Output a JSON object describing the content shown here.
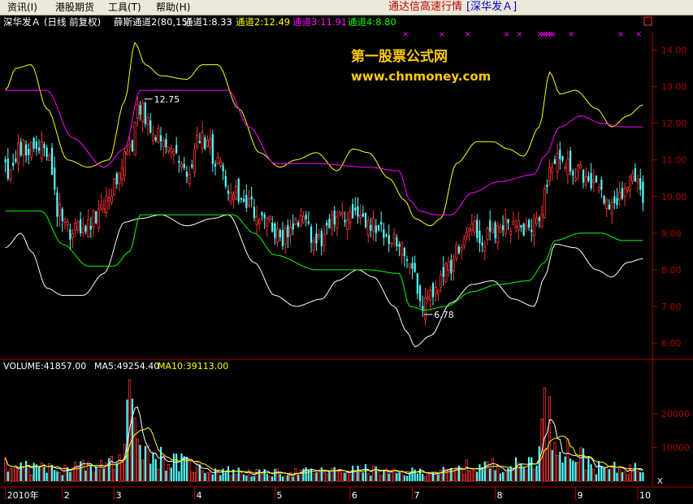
{
  "menu": {
    "items": [
      "资讯(I)",
      "港股期货",
      "工具(T)",
      "帮助(H)"
    ],
    "title": "通达信高速行情",
    "symbol": "[深华发Ａ]"
  },
  "header": {
    "stock_name": "深华发Ａ",
    "period": "(日线 前复权)",
    "indicator": "薛斯通道2(80,15)",
    "channels": [
      {
        "label": "通道1:8.33",
        "color": "#ffffff"
      },
      {
        "label": "通道2:12.49",
        "color": "#ffff00"
      },
      {
        "label": "通道3:11.91",
        "color": "#ff00ff"
      },
      {
        "label": "通道4:8.80",
        "color": "#00ff00"
      }
    ],
    "window_box": "□"
  },
  "watermark": {
    "line1": "第一股票公式网",
    "line2": "www.chnmoney.com"
  },
  "annotations": {
    "high": "12.75",
    "low": "6.78"
  },
  "volume_header": {
    "volume": "VOLUME:41857.00",
    "ma5": "MA5:49254.40",
    "ma10": "MA10:39113.00"
  },
  "volume_corner": "X",
  "colors": {
    "up": "#ff3232",
    "down": "#54fcfc",
    "axis": "#b00000",
    "ch1": "#ffffff",
    "ch2": "#ffff00",
    "ch3": "#ff00ff",
    "ch4": "#00ff00",
    "x_marker": "#ff00ff"
  },
  "chart_data": [
    {
      "type": "candlestick",
      "ylim": [
        5.6,
        14.5
      ],
      "y_ticks": [
        6.0,
        7.0,
        8.0,
        9.0,
        10.0,
        11.0,
        12.0,
        13.0,
        14.0
      ],
      "close_anchors": [
        [
          0,
          10.7
        ],
        [
          6,
          11.3
        ],
        [
          12,
          11.4
        ],
        [
          16,
          11.1
        ],
        [
          20,
          9.7
        ],
        [
          26,
          9.0
        ],
        [
          32,
          9.2
        ],
        [
          36,
          9.5
        ],
        [
          42,
          10.3
        ],
        [
          48,
          11.2
        ],
        [
          52,
          12.5
        ],
        [
          56,
          11.9
        ],
        [
          62,
          11.3
        ],
        [
          70,
          10.8
        ],
        [
          76,
          11.6
        ],
        [
          82,
          11.0
        ],
        [
          86,
          10.3
        ],
        [
          92,
          9.8
        ],
        [
          100,
          9.3
        ],
        [
          108,
          8.9
        ],
        [
          114,
          9.3
        ],
        [
          120,
          8.7
        ],
        [
          126,
          9.4
        ],
        [
          132,
          9.4
        ],
        [
          136,
          9.5
        ],
        [
          140,
          9.2
        ],
        [
          146,
          9.0
        ],
        [
          152,
          8.8
        ],
        [
          158,
          7.8
        ],
        [
          160,
          7.1
        ],
        [
          164,
          7.3
        ],
        [
          170,
          7.9
        ],
        [
          176,
          8.6
        ],
        [
          180,
          9.2
        ],
        [
          184,
          8.8
        ],
        [
          188,
          9.0
        ],
        [
          194,
          9.3
        ],
        [
          200,
          9.0
        ],
        [
          206,
          9.5
        ],
        [
          210,
          10.6
        ],
        [
          212,
          11.1
        ],
        [
          218,
          10.8
        ],
        [
          224,
          10.6
        ],
        [
          228,
          10.2
        ],
        [
          232,
          9.8
        ],
        [
          238,
          10.1
        ],
        [
          244,
          10.5
        ],
        [
          246,
          10.0
        ]
      ],
      "channel1_white_anchors": [
        [
          0,
          8.6
        ],
        [
          6,
          9.0
        ],
        [
          10,
          8.5
        ],
        [
          16,
          7.5
        ],
        [
          22,
          7.3
        ],
        [
          30,
          7.3
        ],
        [
          38,
          7.9
        ],
        [
          46,
          9.3
        ],
        [
          52,
          9.4
        ],
        [
          60,
          9.5
        ],
        [
          70,
          9.2
        ],
        [
          80,
          9.4
        ],
        [
          86,
          9.5
        ],
        [
          96,
          8.2
        ],
        [
          104,
          7.3
        ],
        [
          112,
          7.0
        ],
        [
          122,
          7.2
        ],
        [
          128,
          7.7
        ],
        [
          136,
          8.0
        ],
        [
          142,
          7.8
        ],
        [
          150,
          7.0
        ],
        [
          155,
          6.3
        ],
        [
          158,
          5.9
        ],
        [
          164,
          6.2
        ],
        [
          172,
          7.1
        ],
        [
          180,
          7.6
        ],
        [
          188,
          7.7
        ],
        [
          196,
          7.2
        ],
        [
          204,
          7.0
        ],
        [
          208,
          7.8
        ],
        [
          212,
          8.7
        ],
        [
          220,
          8.6
        ],
        [
          228,
          8.0
        ],
        [
          234,
          7.8
        ],
        [
          240,
          8.2
        ],
        [
          246,
          8.3
        ]
      ],
      "channel2_yellow_anchors": [
        [
          0,
          12.9
        ],
        [
          4,
          13.5
        ],
        [
          10,
          13.6
        ],
        [
          16,
          12.4
        ],
        [
          24,
          11.0
        ],
        [
          32,
          10.8
        ],
        [
          40,
          11.0
        ],
        [
          46,
          12.6
        ],
        [
          50,
          14.2
        ],
        [
          54,
          13.6
        ],
        [
          60,
          13.3
        ],
        [
          70,
          13.2
        ],
        [
          76,
          13.6
        ],
        [
          82,
          13.6
        ],
        [
          90,
          12.4
        ],
        [
          98,
          11.2
        ],
        [
          106,
          10.8
        ],
        [
          112,
          11.0
        ],
        [
          120,
          11.2
        ],
        [
          128,
          10.7
        ],
        [
          134,
          11.3
        ],
        [
          140,
          11.2
        ],
        [
          148,
          10.5
        ],
        [
          154,
          9.9
        ],
        [
          158,
          9.4
        ],
        [
          164,
          9.2
        ],
        [
          168,
          9.4
        ],
        [
          174,
          10.9
        ],
        [
          182,
          11.5
        ],
        [
          188,
          11.5
        ],
        [
          194,
          11.3
        ],
        [
          200,
          11.1
        ],
        [
          206,
          11.9
        ],
        [
          210,
          13.4
        ],
        [
          214,
          12.8
        ],
        [
          220,
          12.9
        ],
        [
          228,
          12.4
        ],
        [
          234,
          11.9
        ],
        [
          240,
          12.2
        ],
        [
          246,
          12.5
        ]
      ],
      "channel3_magenta_anchors": [
        [
          0,
          12.9
        ],
        [
          16,
          12.9
        ],
        [
          26,
          11.6
        ],
        [
          38,
          10.8
        ],
        [
          46,
          11.3
        ],
        [
          52,
          12.9
        ],
        [
          68,
          12.9
        ],
        [
          80,
          12.9
        ],
        [
          86,
          12.9
        ],
        [
          94,
          11.9
        ],
        [
          104,
          10.9
        ],
        [
          120,
          10.9
        ],
        [
          140,
          10.8
        ],
        [
          152,
          10.7
        ],
        [
          156,
          9.9
        ],
        [
          160,
          9.6
        ],
        [
          166,
          9.5
        ],
        [
          172,
          9.5
        ],
        [
          180,
          10.1
        ],
        [
          190,
          10.4
        ],
        [
          204,
          10.6
        ],
        [
          208,
          11.1
        ],
        [
          214,
          11.9
        ],
        [
          222,
          12.2
        ],
        [
          230,
          12.0
        ],
        [
          238,
          11.9
        ],
        [
          246,
          11.9
        ]
      ],
      "channel4_green_anchors": [
        [
          0,
          9.6
        ],
        [
          14,
          9.6
        ],
        [
          22,
          8.7
        ],
        [
          32,
          8.1
        ],
        [
          42,
          8.1
        ],
        [
          48,
          8.5
        ],
        [
          52,
          9.5
        ],
        [
          68,
          9.5
        ],
        [
          80,
          9.5
        ],
        [
          88,
          9.5
        ],
        [
          96,
          9.0
        ],
        [
          104,
          8.4
        ],
        [
          120,
          8.0
        ],
        [
          140,
          8.0
        ],
        [
          152,
          7.9
        ],
        [
          156,
          7.0
        ],
        [
          162,
          6.9
        ],
        [
          170,
          7.0
        ],
        [
          180,
          7.4
        ],
        [
          190,
          7.6
        ],
        [
          202,
          7.7
        ],
        [
          208,
          8.2
        ],
        [
          212,
          8.8
        ],
        [
          222,
          9.0
        ],
        [
          230,
          9.0
        ],
        [
          238,
          8.8
        ],
        [
          246,
          8.8
        ]
      ],
      "x_markers_at_days": [
        154,
        168,
        178,
        193,
        198,
        206,
        207,
        208,
        209,
        210,
        211,
        218,
        237,
        244
      ]
    },
    {
      "type": "bar",
      "series": [
        {
          "name": "VOLUME",
          "values_anchors": [
            [
              0,
              6000
            ],
            [
              10,
              4000
            ],
            [
              20,
              3500
            ],
            [
              30,
              4500
            ],
            [
              45,
              6000
            ],
            [
              48,
              26000
            ],
            [
              50,
              21000
            ],
            [
              55,
              9000
            ],
            [
              65,
              6000
            ],
            [
              80,
              3500
            ],
            [
              100,
              2500
            ],
            [
              120,
              3000
            ],
            [
              140,
              3500
            ],
            [
              150,
              2500
            ],
            [
              160,
              3000
            ],
            [
              170,
              3000
            ],
            [
              180,
              4500
            ],
            [
              190,
              5000
            ],
            [
              200,
              5000
            ],
            [
              206,
              9000
            ],
            [
              208,
              22000
            ],
            [
              212,
              14000
            ],
            [
              220,
              8000
            ],
            [
              230,
              4000
            ],
            [
              240,
              4000
            ],
            [
              246,
              4000
            ]
          ]
        },
        {
          "name": "MA5"
        },
        {
          "name": "MA10"
        }
      ],
      "ylim": [
        0,
        32000
      ],
      "y_ticks": [
        10000,
        20000
      ],
      "x_tick_labels": [
        "2010年",
        "2",
        "3",
        "4",
        "5",
        "6",
        "7",
        "8",
        "9",
        "10"
      ],
      "x_tick_days": [
        0,
        22,
        42,
        73,
        104,
        133,
        157,
        189,
        220,
        244
      ]
    }
  ]
}
